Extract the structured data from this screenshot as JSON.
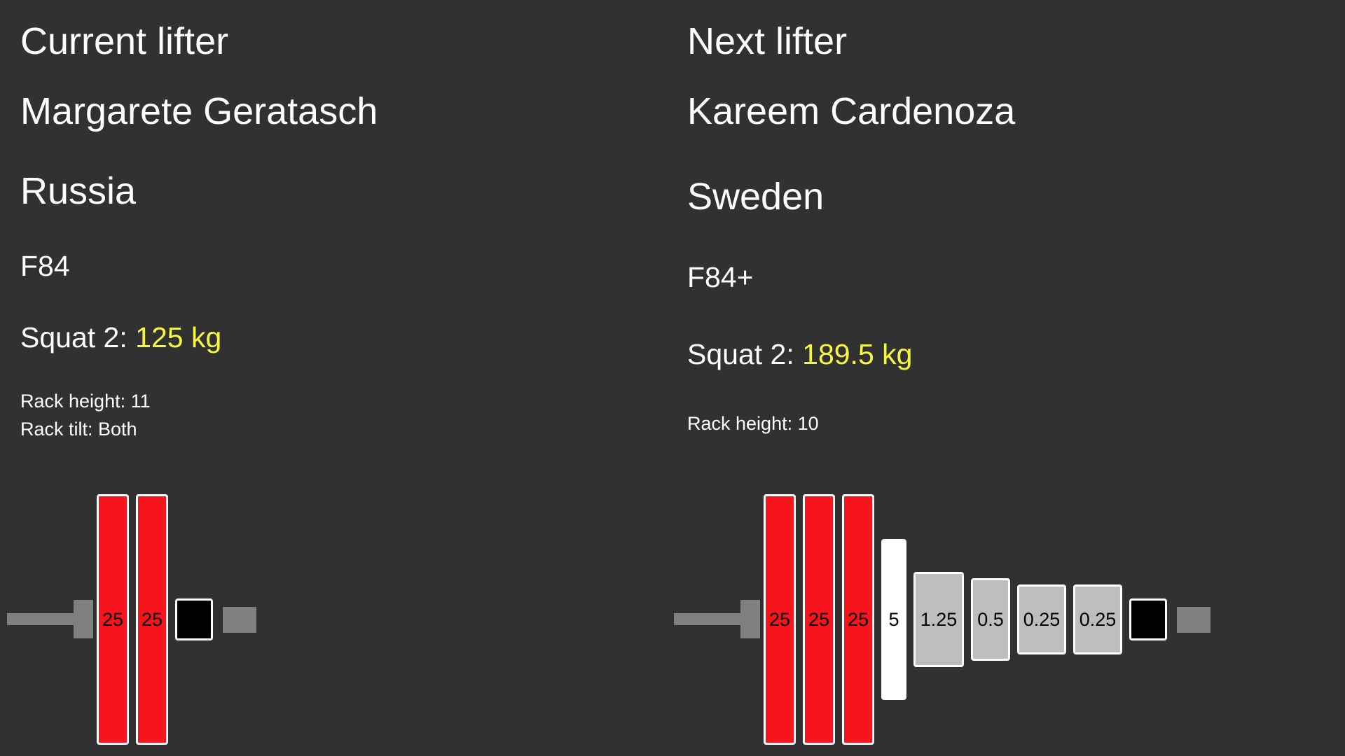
{
  "current": {
    "heading": "Current lifter",
    "name": "Margarete Geratasch",
    "country": "Russia",
    "weight_class": "F84",
    "attempt_label": "Squat 2:",
    "attempt_weight": "125 kg",
    "rack_height": "Rack height: 11",
    "rack_tilt": "Rack tilt: Both",
    "plates": [
      {
        "label": "25",
        "kind": "red"
      },
      {
        "label": "25",
        "kind": "red"
      }
    ]
  },
  "next": {
    "heading": "Next lifter",
    "name": "Kareem Cardenoza",
    "country": "Sweden",
    "weight_class": "F84+",
    "attempt_label": "Squat 2:",
    "attempt_weight": "189.5 kg",
    "rack_height": "Rack height: 10",
    "plates": [
      {
        "label": "25",
        "kind": "red"
      },
      {
        "label": "25",
        "kind": "red"
      },
      {
        "label": "25",
        "kind": "red"
      },
      {
        "label": "5",
        "kind": "white"
      },
      {
        "label": "1.25",
        "kind": "grey"
      },
      {
        "label": "0.5",
        "kind": "grey"
      },
      {
        "label": "0.25",
        "kind": "grey"
      },
      {
        "label": "0.25",
        "kind": "grey"
      }
    ]
  },
  "colors": {
    "background": "#313131",
    "text": "#ffffff",
    "weight_highlight": "#f7f640",
    "plate_red": "#f7141d",
    "plate_white": "#ffffff",
    "plate_grey": "#bebebe",
    "bar": "#808080",
    "collar": "#000000"
  }
}
